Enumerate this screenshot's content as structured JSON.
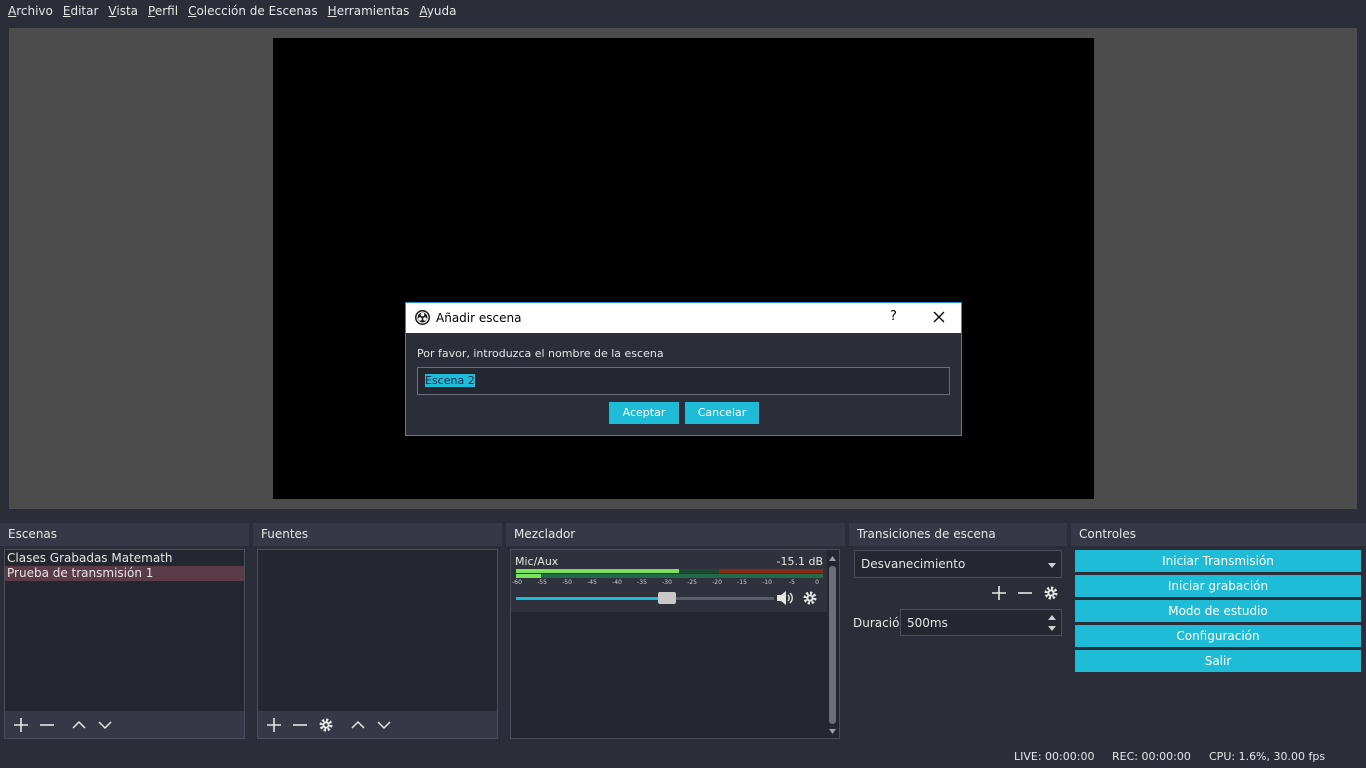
{
  "menu": [
    {
      "label": "Archivo",
      "hot": "A",
      "rest": "rchivo"
    },
    {
      "label": "Editar",
      "hot": "E",
      "rest": "ditar"
    },
    {
      "label": "Vista",
      "hot": "V",
      "rest": "ista"
    },
    {
      "label": "Perfil",
      "hot": "P",
      "rest": "erfil"
    },
    {
      "label": "Colección de Escenas",
      "hot": "C",
      "rest": "olección de Escenas"
    },
    {
      "label": "Herramientas",
      "hot": "H",
      "rest": "erramientas"
    },
    {
      "label": "Ayuda",
      "hot": "A",
      "rest": "yuda"
    }
  ],
  "docks": {
    "scenes": {
      "title": "Escenas",
      "items": [
        "Clases Grabadas Matemath",
        "Prueba de transmisión 1"
      ],
      "selected_index": 1
    },
    "sources": {
      "title": "Fuentes"
    },
    "mixer": {
      "title": "Mezclador",
      "channel": "Mic/Aux",
      "db": "-15.1 dB",
      "ticks": [
        "-60",
        "-55",
        "-50",
        "-45",
        "-40",
        "-35",
        "-30",
        "-25",
        "-20",
        "-15",
        "-10",
        "-5",
        "0"
      ],
      "fader_level": 0.55
    },
    "transitions": {
      "title": "Transiciones de escena",
      "selected": "Desvanecimiento",
      "duration_label": "Duración",
      "duration": "500ms"
    },
    "controls": {
      "title": "Controles",
      "buttons": [
        "Iniciar Transmisión",
        "Iniciar grabación",
        "Modo de estudio",
        "Configuración",
        "Salir"
      ]
    }
  },
  "status": {
    "live": "LIVE: 00:00:00",
    "rec": "REC: 00:00:00",
    "cpu": "CPU: 1.6%, 30.00 fps"
  },
  "dialog": {
    "title": "Añadir escena",
    "help": "?",
    "prompt": "Por favor, introduzca el nombre de la escena",
    "value": "Escena 2",
    "ok": "Aceptar",
    "cancel": "Cancelar"
  },
  "colors": {
    "accent": "#1ebcd6",
    "background": "#2b2e38",
    "panel": "#24272f",
    "selected_row": "#5a3b47"
  }
}
